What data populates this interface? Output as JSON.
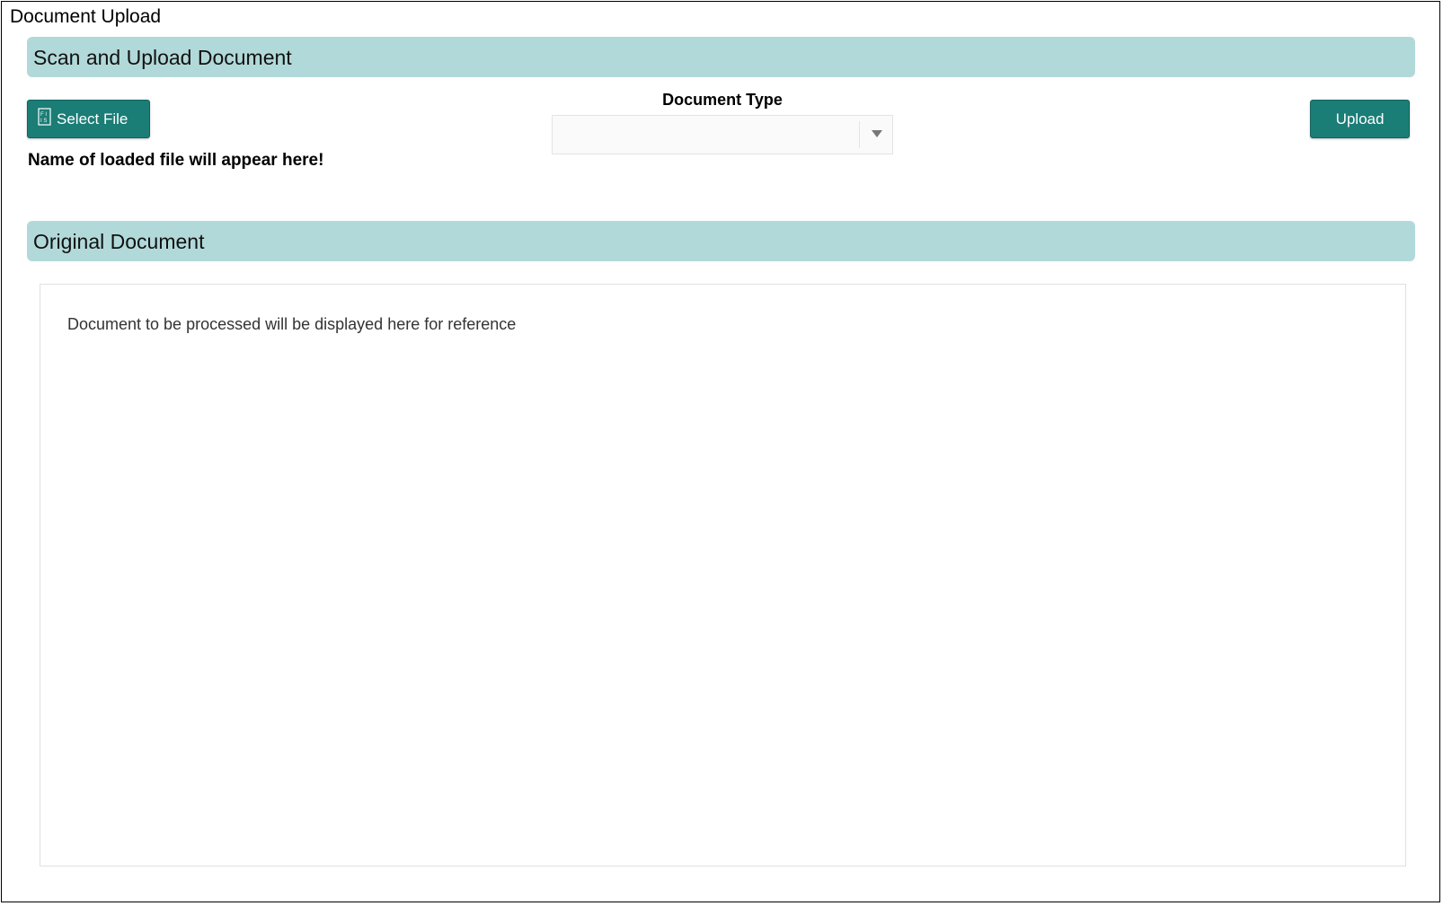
{
  "page": {
    "title": "Document Upload"
  },
  "scan_section": {
    "header": "Scan and Upload Document",
    "select_file_label": "Select File",
    "select_file_icon": "file-icon",
    "file_name_placeholder": "Name of loaded file will appear here!",
    "document_type": {
      "label": "Document Type",
      "selected_value": ""
    },
    "upload_label": "Upload"
  },
  "original_section": {
    "header": "Original Document",
    "placeholder": "Document to be processed will be displayed here for reference"
  },
  "colors": {
    "section_header_bg": "#b2d9d9",
    "button_bg": "#1a7d76"
  }
}
